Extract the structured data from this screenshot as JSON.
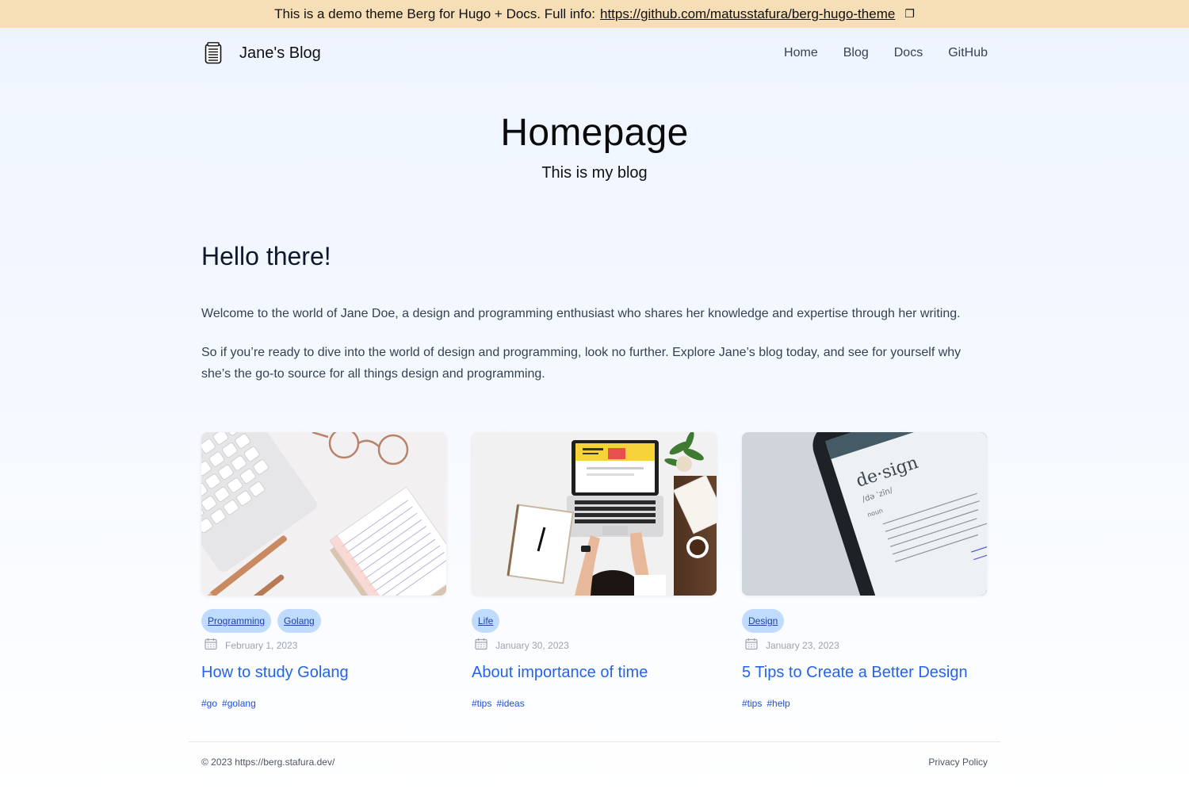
{
  "banner": {
    "text": "This is a demo theme Berg for Hugo + Docs. Full info:",
    "link": "https://github.com/matusstafura/berg-hugo-theme",
    "external_icon": "❐"
  },
  "nav": {
    "brand": "Jane's Blog",
    "logo_icon": "notepad-icon",
    "links": [
      "Home",
      "Blog",
      "Docs",
      "GitHub"
    ]
  },
  "hero": {
    "title": "Homepage",
    "subtitle": "This is my blog"
  },
  "intro": {
    "heading": "Hello there!",
    "p1": "Welcome to the world of Jane Doe, a design and programming enthusiast who shares her knowledge and expertise through her writing.",
    "p2": "So if you’re ready to dive into the world of design and programming, look no further. Explore Jane’s blog today, and see for yourself why she’s the go-to source for all things design and programming."
  },
  "posts": [
    {
      "categories": [
        "Programming",
        "Golang"
      ],
      "date": "February 1, 2023",
      "title": "How to study Golang",
      "tags": [
        "#go",
        "#golang"
      ]
    },
    {
      "categories": [
        "Life"
      ],
      "date": "January 30, 2023",
      "title": "About importance of time",
      "tags": [
        "#tips",
        "#ideas"
      ]
    },
    {
      "categories": [
        "Design"
      ],
      "date": "January 23, 2023",
      "title": "5 Tips to Create a Better Design",
      "tags": [
        "#tips",
        "#help"
      ]
    }
  ],
  "footer": {
    "copyright": "© 2023 https://berg.stafura.dev/",
    "privacy": "Privacy Policy"
  },
  "colors": {
    "banner": "#f6dfb6",
    "accent": "#2563eb",
    "category_bg": "#bfdbfe"
  }
}
